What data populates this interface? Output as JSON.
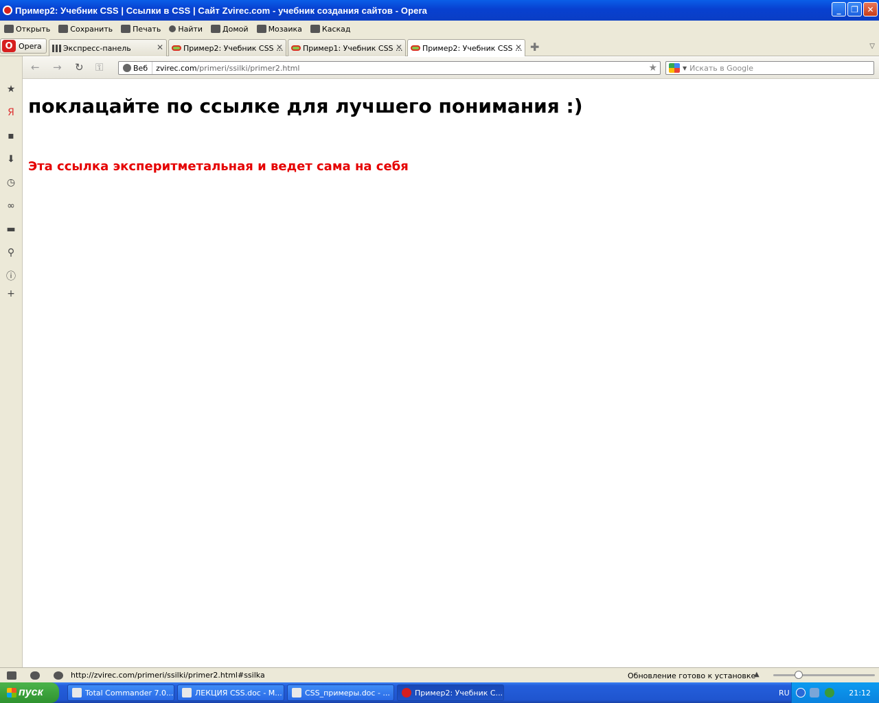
{
  "window": {
    "title": "Пример2: Учебник CSS | Ссылки в CSS | Сайт Zvirec.com - учебник создания сайтов - Opera",
    "min": "_",
    "max": "❐",
    "close": "✕"
  },
  "menubar": {
    "items": [
      {
        "label": "Открыть",
        "icon": "open-icon"
      },
      {
        "label": "Сохранить",
        "icon": "save-icon"
      },
      {
        "label": "Печать",
        "icon": "print-icon"
      },
      {
        "label": "Найти",
        "icon": "search-icon"
      },
      {
        "label": "Домой",
        "icon": "home-icon"
      },
      {
        "label": "Мозаика",
        "icon": "tile-icon"
      },
      {
        "label": "Каскад",
        "icon": "cascade-icon"
      }
    ]
  },
  "tabs": {
    "opera_label": "Opera",
    "items": [
      {
        "label": "Экспресс-панель",
        "active": false
      },
      {
        "label": "Пример2: Учебник CSS ...",
        "active": false
      },
      {
        "label": "Пример1: Учебник CSS ...",
        "active": false
      },
      {
        "label": "Пример2: Учебник CSS ...",
        "active": true
      }
    ],
    "new_tab": "✚",
    "menu": "▽"
  },
  "address": {
    "web_label": "Веб",
    "url_host": "zvirec.com",
    "url_path": "/primeri/ssilki/primer2.html",
    "search_placeholder": "Искать в Google"
  },
  "content": {
    "heading": "поклацайте по ссылке для лучшего понимания :)",
    "link_text": "Эта ссылка эксперитметальная и ведет сама на себя",
    "link_color": "#e50000"
  },
  "status": {
    "hover_url": "http://zvirec.com/primeri/ssilki/primer2.html#ssilka",
    "update_text": "Обновление готово к установке",
    "zoom_level": 0.25
  },
  "taskbar": {
    "start_label": "пуск",
    "tasks": [
      {
        "label": "Total Commander 7.0...",
        "active": false
      },
      {
        "label": "ЛЕКЦИЯ CSS.doc - M...",
        "active": false
      },
      {
        "label": "CSS_примеры.doc - ...",
        "active": false
      },
      {
        "label": "Пример2: Учебник C...",
        "active": true
      }
    ],
    "language": "RU",
    "clock": "21:12"
  }
}
